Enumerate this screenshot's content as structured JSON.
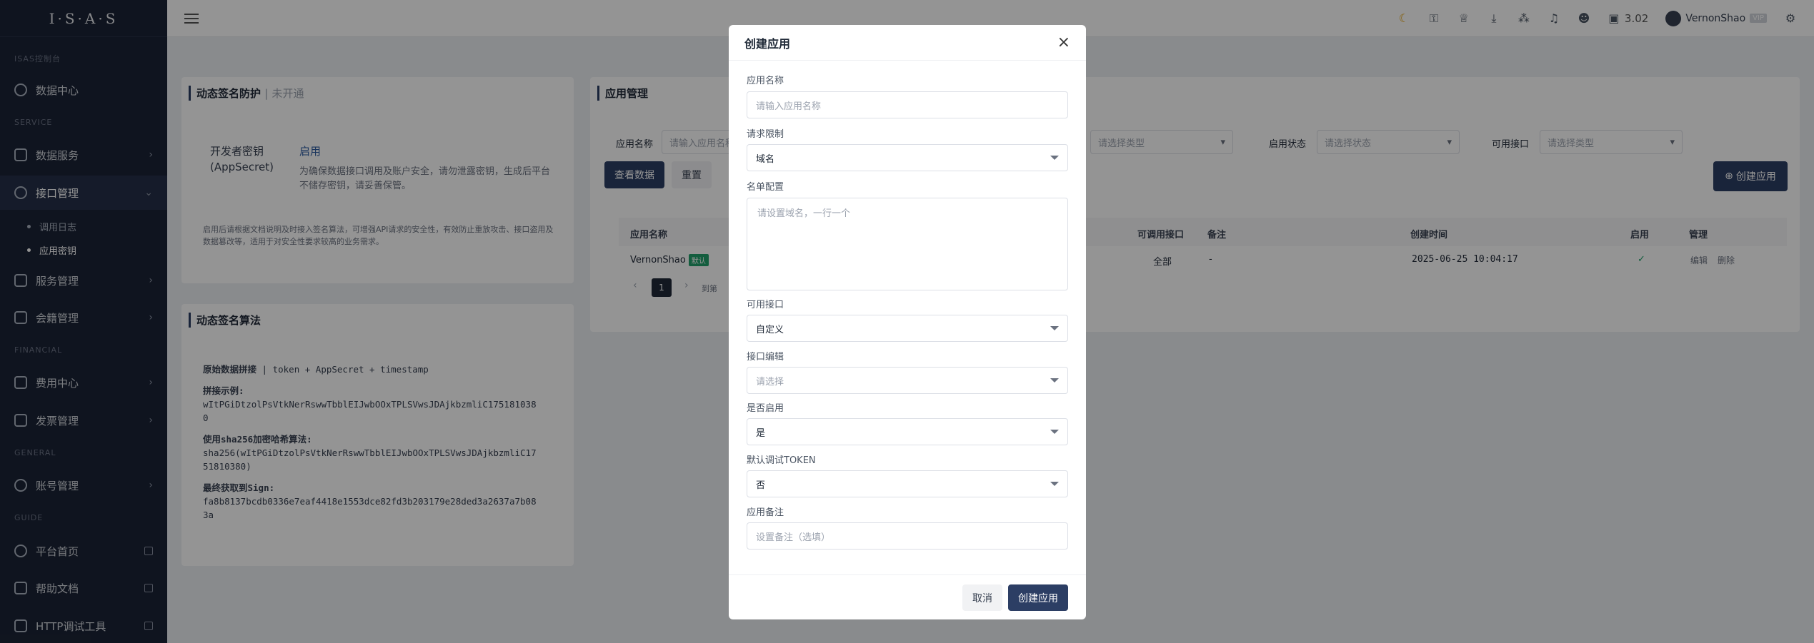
{
  "sidebar": {
    "logo": "I·S·A·S",
    "sections": [
      "ISAS控制台",
      "SERVICE",
      "FINANCIAL",
      "GENERAL",
      "GUIDE"
    ],
    "items": [
      {
        "label": "数据中心"
      },
      {
        "label": "数据服务"
      },
      {
        "label": "接口管理"
      },
      {
        "label": "调用日志"
      },
      {
        "label": "应用密钥"
      },
      {
        "label": "服务管理"
      },
      {
        "label": "会籍管理"
      },
      {
        "label": "费用中心"
      },
      {
        "label": "发票管理"
      },
      {
        "label": "账号管理"
      },
      {
        "label": "平台首页"
      },
      {
        "label": "帮助文档"
      },
      {
        "label": "HTTP调试工具"
      }
    ]
  },
  "topbar": {
    "balance": "3.02",
    "username": "VernonShao",
    "user_badge": "VIP"
  },
  "sign_card": {
    "title": "动态签名防护",
    "status": "未开通",
    "key_label_1": "开发者密钥",
    "key_label_2": "(AppSecret)",
    "enable_link": "启用",
    "desc": "为确保数据接口调用及账户安全，请勿泄露密钥，生成后平台不储存密钥，请妥善保管。",
    "note": "启用后请根据文档说明及时接入签名算法，可增强API请求的安全性，有效防止重放攻击、接口盗用及数据篡改等，适用于对安全性要求较高的业务需求。"
  },
  "algo_card": {
    "title": "动态签名算法",
    "step1_label": "原始数据拼接",
    "step1_formula": "token + AppSecret + timestamp",
    "step2_label": "拼接示例:",
    "step2_value": "wItPGiDtzolPsVtkNerRswwTbblEIJwbOOxTPLSVwsJDAjkbzmliC175181038",
    "step2_value_cont": "0",
    "step3_label": "使用sha256加密哈希算法:",
    "step3_value": "sha256(wItPGiDtzolPsVtkNerRswwTbblEIJwbOOxTPLSVwsJDAjkbzmliC17",
    "step3_value_cont": "51810380)",
    "step4_label": "最终获取到Sign:",
    "step4_value": "fa8b8137bcdb0336e7eaf4418e1553dce82fd3b203179e28ded3a2637a7b08",
    "step4_value_cont": "3a"
  },
  "app_card": {
    "title": "应用管理",
    "filter_name_label": "应用名称",
    "filter_name_placeholder": "请输入应用名称",
    "filter_type_placeholder": "请选择类型",
    "filter_status_label": "启用状态",
    "filter_status_placeholder": "请选择状态",
    "filter_api_label": "可用接口",
    "filter_api_placeholder": "请选择类型",
    "search_btn": "查看数据",
    "reset_btn": "重置",
    "create_btn": "创建应用",
    "columns": [
      "应用名称",
      "可调用接口",
      "备注",
      "创建时间",
      "启用",
      "管理"
    ],
    "row": {
      "name": "VernonShao",
      "default_tag": "默认",
      "apis": "全部",
      "note": "-",
      "created": "2025-06-25 10:04:17",
      "enabled": "✓",
      "edit": "编辑",
      "delete": "删除"
    },
    "pagination": {
      "page": "1",
      "goto": "到第"
    }
  },
  "modal": {
    "title": "创建应用",
    "name_label": "应用名称",
    "name_placeholder": "请输入应用名称",
    "limit_label": "请求限制",
    "limit_value": "域名",
    "list_label": "名单配置",
    "list_placeholder": "请设置域名，一行一个",
    "api_label": "可用接口",
    "api_value": "自定义",
    "api_edit_label": "接口编辑",
    "api_edit_placeholder": "请选择",
    "enable_label": "是否启用",
    "enable_value": "是",
    "token_label": "默认调试TOKEN",
    "token_value": "否",
    "note_label": "应用备注",
    "note_placeholder": "设置备注（选填）",
    "cancel": "取消",
    "confirm": "创建应用"
  },
  "colors": {
    "primary": "#2c3e64",
    "sidebar": "#1b2436",
    "success": "#22a06b"
  }
}
